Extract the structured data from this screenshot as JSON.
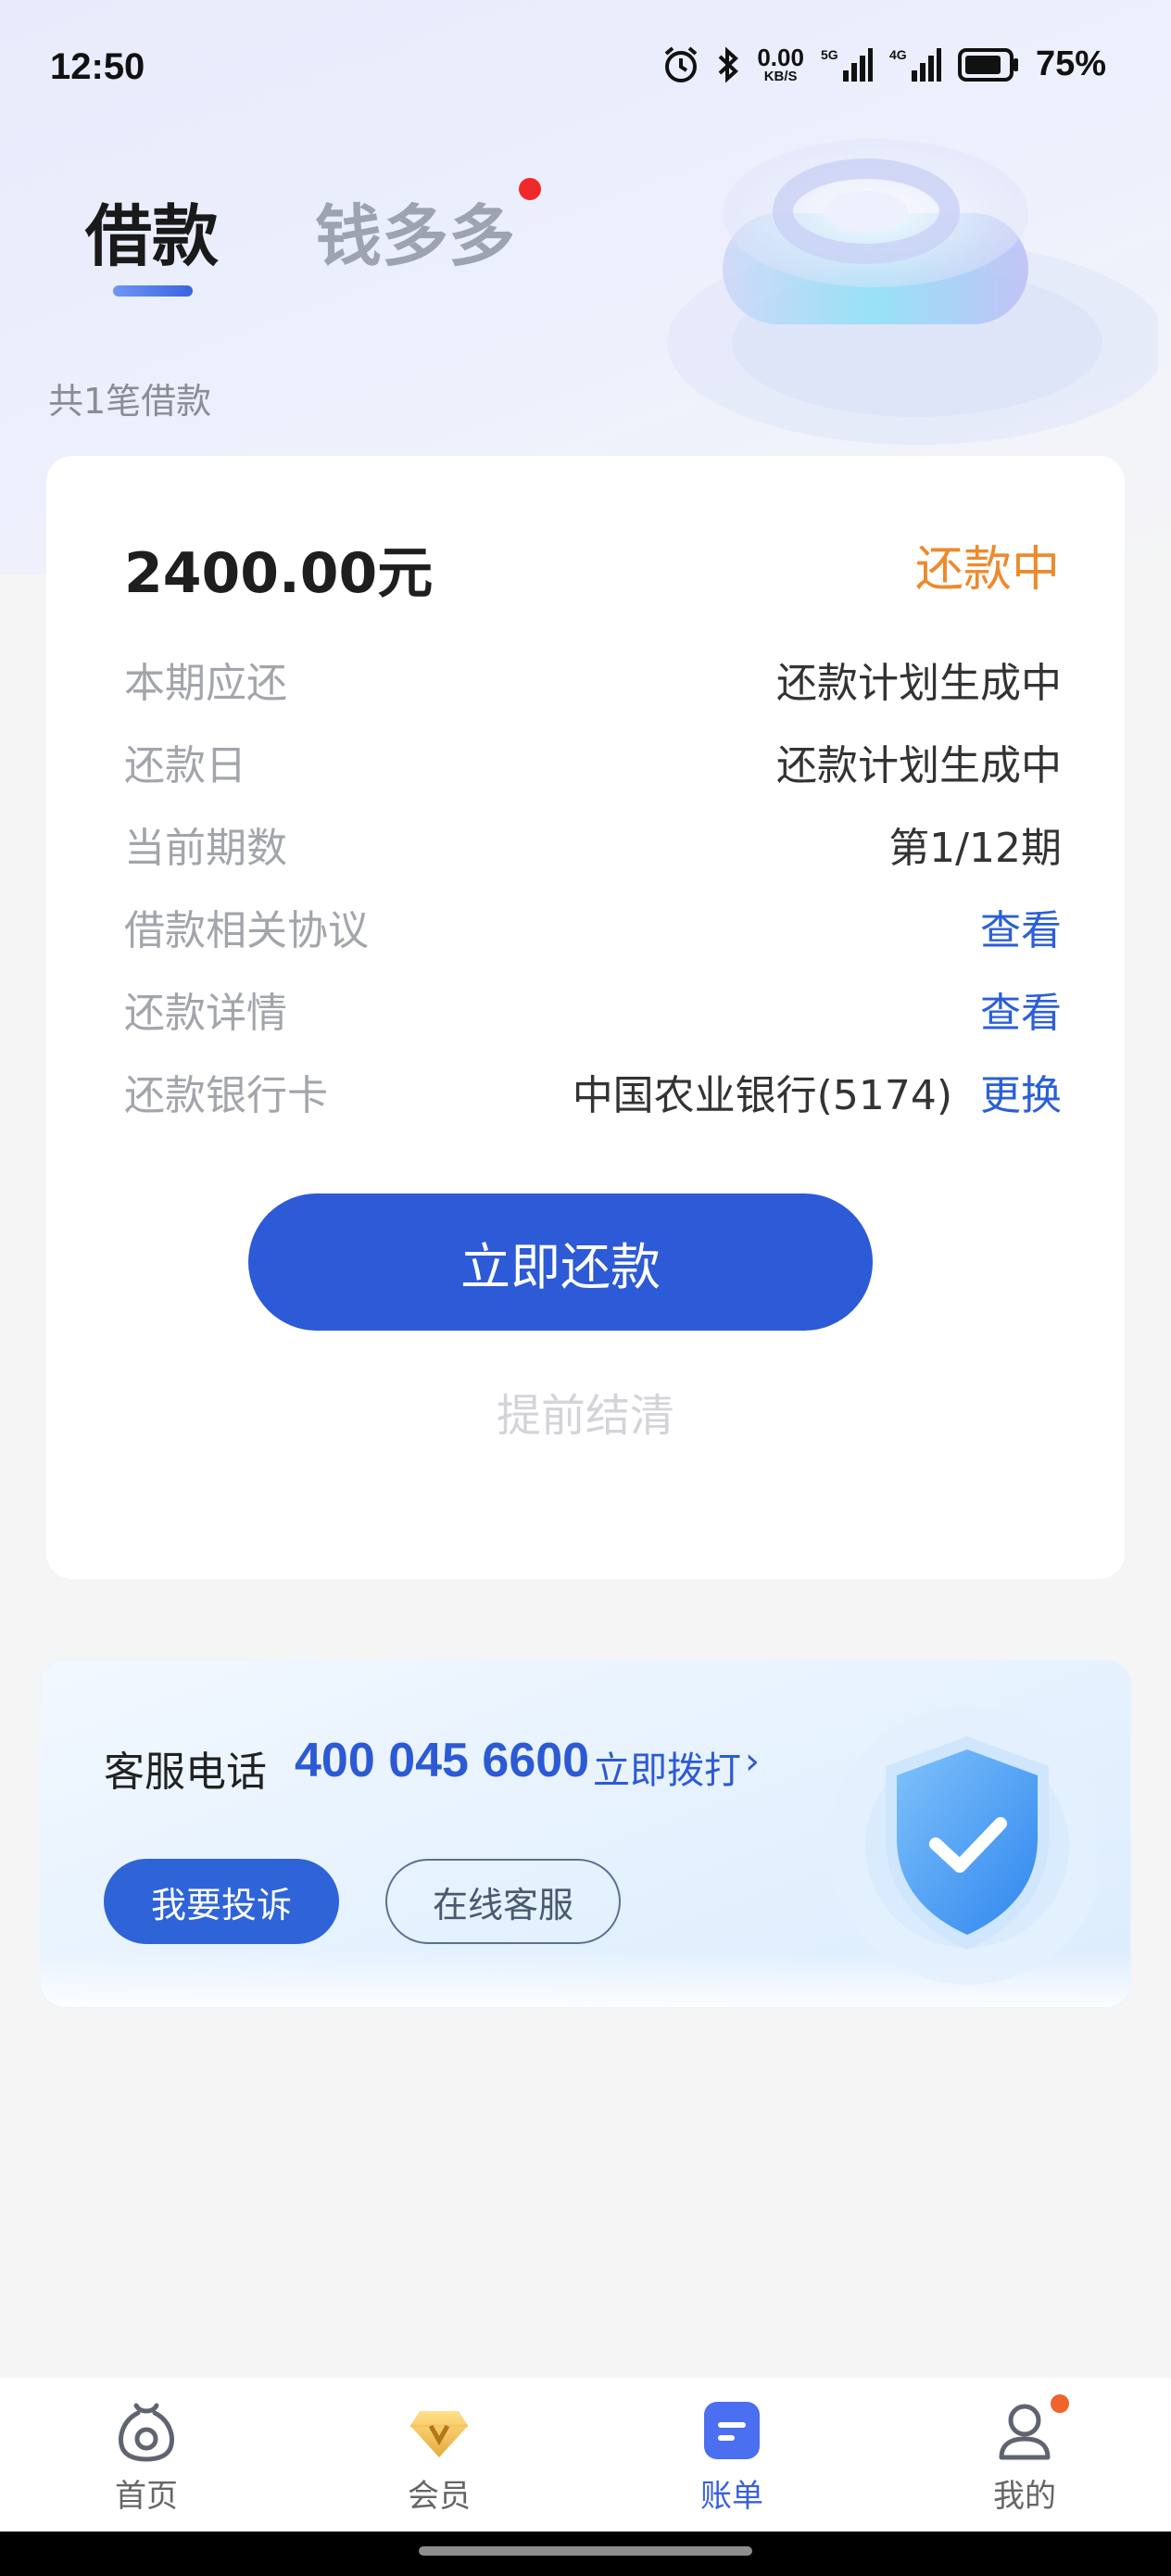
{
  "status_bar": {
    "time": "12:50",
    "net_speed_value": "0.00",
    "net_speed_unit": "KB/S",
    "signal_1_label": "5G",
    "signal_2_label": "4G",
    "battery": "75%"
  },
  "tabs": [
    {
      "label": "借款",
      "active": true
    },
    {
      "label": "钱多多",
      "active": false,
      "badge_dot": true
    }
  ],
  "loan_count_text": "共1笔借款",
  "loan": {
    "amount": "2400.00元",
    "status": "还款中",
    "status_color": "#ee8a2c",
    "rows": [
      {
        "label": "本期应还",
        "value": "还款计划生成中"
      },
      {
        "label": "还款日",
        "value": "还款计划生成中"
      },
      {
        "label": "当前期数",
        "value": "第1/12期"
      },
      {
        "label": "借款相关协议",
        "link": "查看"
      },
      {
        "label": "还款详情",
        "link": "查看"
      },
      {
        "label": "还款银行卡",
        "value": "中国农业银行(5174)",
        "link": "更换"
      }
    ],
    "repay_button": "立即还款",
    "prepay_link": "提前结清"
  },
  "service": {
    "label": "客服电话",
    "phone": "400 045 6600",
    "dial": "立即拨打",
    "dial_arrow": "›",
    "complain_button": "我要投诉",
    "online_button": "在线客服"
  },
  "bottom_nav": [
    {
      "label": "首页",
      "icon": "money-bag-icon",
      "active": false
    },
    {
      "label": "会员",
      "icon": "diamond-v-icon",
      "active": false
    },
    {
      "label": "账单",
      "icon": "bill-icon",
      "active": true
    },
    {
      "label": "我的",
      "icon": "user-icon",
      "active": false,
      "badge_dot": true
    }
  ],
  "colors": {
    "accent": "#2d5ad6",
    "link": "#2b5fd9",
    "status_orange": "#ee8a2c",
    "badge_red": "#f02a2a"
  }
}
